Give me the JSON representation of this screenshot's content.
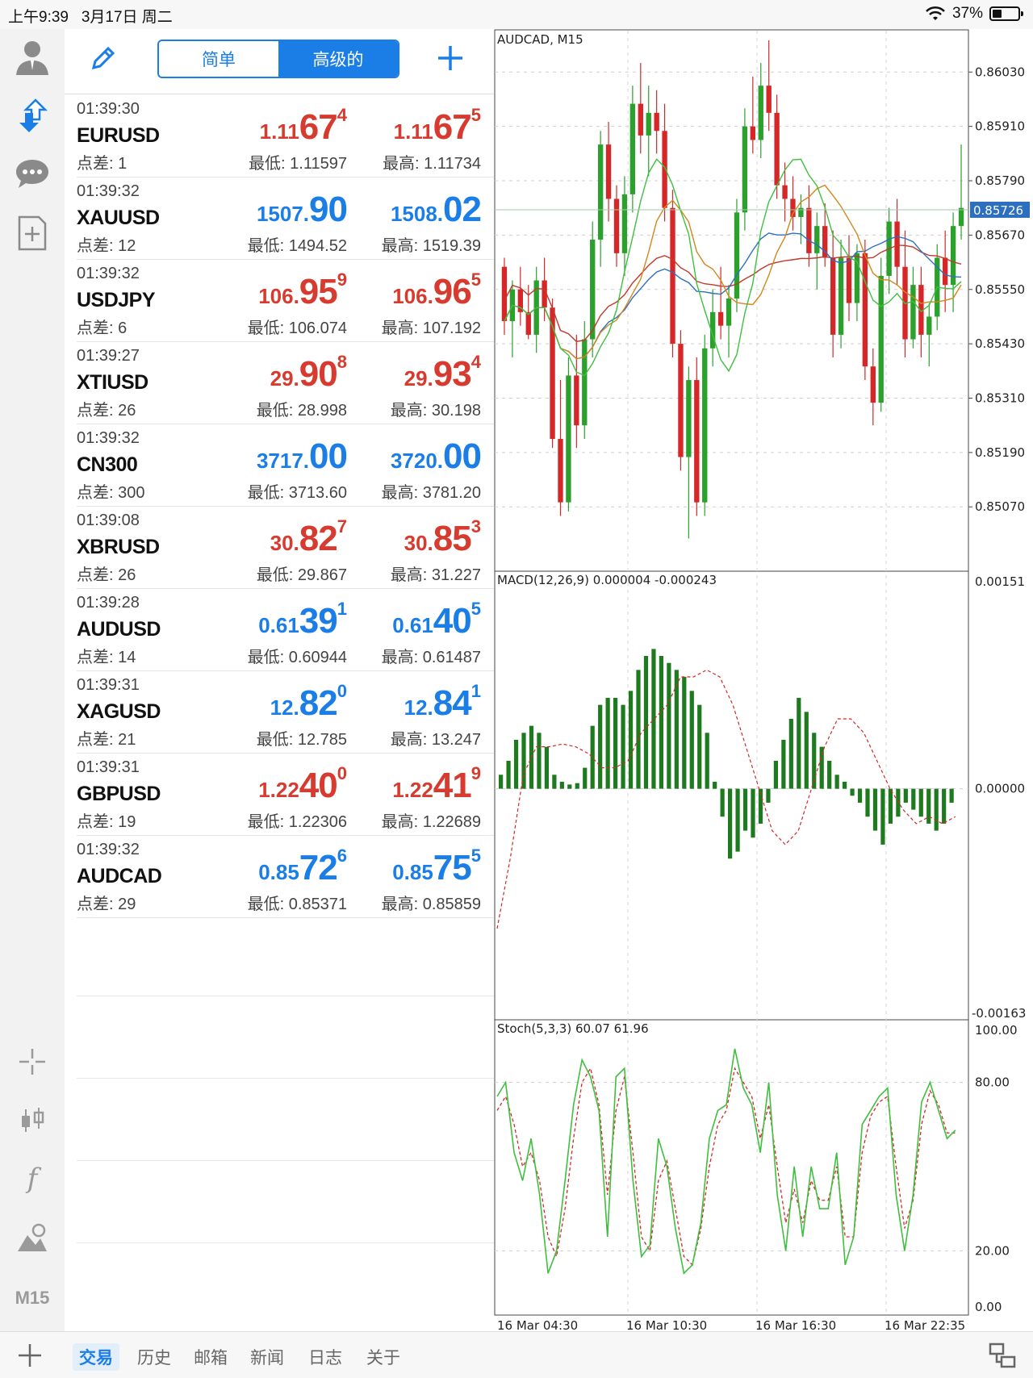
{
  "status_bar": {
    "time": "上午9:39",
    "date": "3月17日 周二",
    "battery": "37%",
    "battery_level": 0.37
  },
  "toolbar": {
    "seg_simple": "简单",
    "seg_advanced": "高级的"
  },
  "quotes": [
    {
      "time": "01:39:30",
      "symbol": "EURUSD",
      "spread": "点差: 1",
      "color": "red",
      "bid": {
        "pre": "1.11",
        "big": "67",
        "sup": "4"
      },
      "ask": {
        "pre": "1.11",
        "big": "67",
        "sup": "5"
      },
      "low": "最低: 1.11597",
      "high": "最高: 1.11734"
    },
    {
      "time": "01:39:32",
      "symbol": "XAUUSD",
      "spread": "点差: 12",
      "color": "blue",
      "bid": {
        "pre": "1507.",
        "big": "90",
        "sup": ""
      },
      "ask": {
        "pre": "1508.",
        "big": "02",
        "sup": ""
      },
      "low": "最低: 1494.52",
      "high": "最高: 1519.39"
    },
    {
      "time": "01:39:32",
      "symbol": "USDJPY",
      "spread": "点差: 6",
      "color": "red",
      "bid": {
        "pre": "106.",
        "big": "95",
        "sup": "9"
      },
      "ask": {
        "pre": "106.",
        "big": "96",
        "sup": "5"
      },
      "low": "最低: 106.074",
      "high": "最高: 107.192"
    },
    {
      "time": "01:39:27",
      "symbol": "XTIUSD",
      "spread": "点差: 26",
      "color": "red",
      "bid": {
        "pre": "29.",
        "big": "90",
        "sup": "8"
      },
      "ask": {
        "pre": "29.",
        "big": "93",
        "sup": "4"
      },
      "low": "最低: 28.998",
      "high": "最高: 30.198"
    },
    {
      "time": "01:39:32",
      "symbol": "CN300",
      "spread": "点差: 300",
      "color": "blue",
      "bid": {
        "pre": "3717.",
        "big": "00",
        "sup": ""
      },
      "ask": {
        "pre": "3720.",
        "big": "00",
        "sup": ""
      },
      "low": "最低: 3713.60",
      "high": "最高: 3781.20"
    },
    {
      "time": "01:39:08",
      "symbol": "XBRUSD",
      "spread": "点差: 26",
      "color": "red",
      "bid": {
        "pre": "30.",
        "big": "82",
        "sup": "7"
      },
      "ask": {
        "pre": "30.",
        "big": "85",
        "sup": "3"
      },
      "low": "最低: 29.867",
      "high": "最高: 31.227"
    },
    {
      "time": "01:39:28",
      "symbol": "AUDUSD",
      "spread": "点差: 14",
      "color": "blue",
      "bid": {
        "pre": "0.61",
        "big": "39",
        "sup": "1"
      },
      "ask": {
        "pre": "0.61",
        "big": "40",
        "sup": "5"
      },
      "low": "最低: 0.60944",
      "high": "最高: 0.61487"
    },
    {
      "time": "01:39:31",
      "symbol": "XAGUSD",
      "spread": "点差: 21",
      "color": "blue",
      "bid": {
        "pre": "12.",
        "big": "82",
        "sup": "0"
      },
      "ask": {
        "pre": "12.",
        "big": "84",
        "sup": "1"
      },
      "low": "最低: 12.785",
      "high": "最高: 13.247"
    },
    {
      "time": "01:39:31",
      "symbol": "GBPUSD",
      "spread": "点差: 19",
      "color": "red",
      "bid": {
        "pre": "1.22",
        "big": "40",
        "sup": "0"
      },
      "ask": {
        "pre": "1.22",
        "big": "41",
        "sup": "9"
      },
      "low": "最低: 1.22306",
      "high": "最高: 1.22689"
    },
    {
      "time": "01:39:32",
      "symbol": "AUDCAD",
      "spread": "点差: 29",
      "color": "blue",
      "bid": {
        "pre": "0.85",
        "big": "72",
        "sup": "6"
      },
      "ask": {
        "pre": "0.85",
        "big": "75",
        "sup": "5"
      },
      "low": "最低: 0.85371",
      "high": "最高: 0.85859"
    }
  ],
  "sidebar": {
    "timeframe": "M15"
  },
  "bottom_tabs": [
    {
      "label": "交易",
      "active": true
    },
    {
      "label": "历史",
      "active": false
    },
    {
      "label": "邮箱",
      "active": false
    },
    {
      "label": "新闻",
      "active": false
    },
    {
      "label": "日志",
      "active": false
    },
    {
      "label": "关于",
      "active": false
    }
  ],
  "chart_data": {
    "type": "candlestick",
    "symbol_label": "AUDCAD, M15",
    "price_axis": [
      "0.86030",
      "0.85910",
      "0.85790",
      "0.85670",
      "0.85550",
      "0.85430",
      "0.85310",
      "0.85190",
      "0.85070"
    ],
    "price_range": [
      0.8496,
      0.861
    ],
    "current_price": "0.85726",
    "current_value": 0.85726,
    "macd_label": "MACD(12,26,9) 0.000004 -0.000243",
    "macd_axis": {
      "top": "0.00151",
      "zero": "0.00000",
      "bottom": "-0.00163"
    },
    "macd_range": [
      -0.00163,
      0.00151
    ],
    "stoch_label": "Stoch(5,3,3) 60.07 61.96",
    "stoch_axis": [
      "100.00",
      "80.00",
      "20.00",
      "0.00"
    ],
    "stoch_range": [
      0,
      100
    ],
    "time_axis": [
      "16 Mar 04:30",
      "16 Mar 10:30",
      "16 Mar 16:30",
      "16 Mar 22:35"
    ],
    "colors": {
      "up": "#2ca02c",
      "down": "#d62728",
      "macd_hist": "#1e7a1e",
      "signal": "#d62728",
      "ma_red": "#c0392b",
      "ma_blue": "#2c6fbf",
      "ma_orange": "#d4861a",
      "ma_green": "#3fbf3f",
      "current_line": "#2c6fbf"
    },
    "candles": [
      [
        0.856,
        0.8562,
        0.8545,
        0.8548
      ],
      [
        0.8548,
        0.8557,
        0.854,
        0.8555
      ],
      [
        0.8555,
        0.856,
        0.8547,
        0.855
      ],
      [
        0.855,
        0.8556,
        0.8544,
        0.8545
      ],
      [
        0.8545,
        0.856,
        0.8541,
        0.8557
      ],
      [
        0.8557,
        0.8562,
        0.8548,
        0.8551
      ],
      [
        0.8551,
        0.8553,
        0.852,
        0.8522
      ],
      [
        0.8522,
        0.8535,
        0.8505,
        0.8508
      ],
      [
        0.8508,
        0.854,
        0.8506,
        0.8536
      ],
      [
        0.8536,
        0.8545,
        0.852,
        0.8525
      ],
      [
        0.8525,
        0.8548,
        0.8522,
        0.8544
      ],
      [
        0.8544,
        0.857,
        0.854,
        0.8566
      ],
      [
        0.8566,
        0.859,
        0.856,
        0.8587
      ],
      [
        0.8587,
        0.8592,
        0.857,
        0.8575
      ],
      [
        0.8575,
        0.8578,
        0.856,
        0.8563
      ],
      [
        0.8563,
        0.858,
        0.8558,
        0.8576
      ],
      [
        0.8576,
        0.86,
        0.8572,
        0.8596
      ],
      [
        0.8596,
        0.8605,
        0.8585,
        0.8589
      ],
      [
        0.8589,
        0.86,
        0.858,
        0.8594
      ],
      [
        0.8594,
        0.8599,
        0.8585,
        0.859
      ],
      [
        0.859,
        0.8596,
        0.857,
        0.8573
      ],
      [
        0.8573,
        0.8577,
        0.854,
        0.8543
      ],
      [
        0.8543,
        0.8546,
        0.8515,
        0.8518
      ],
      [
        0.8518,
        0.8538,
        0.85,
        0.8535
      ],
      [
        0.8535,
        0.854,
        0.8505,
        0.8508
      ],
      [
        0.8508,
        0.8545,
        0.8505,
        0.8542
      ],
      [
        0.8542,
        0.8555,
        0.8538,
        0.855
      ],
      [
        0.855,
        0.856,
        0.8544,
        0.8547
      ],
      [
        0.8547,
        0.8556,
        0.854,
        0.8553
      ],
      [
        0.8553,
        0.8575,
        0.855,
        0.8572
      ],
      [
        0.8572,
        0.8595,
        0.8568,
        0.8591
      ],
      [
        0.8591,
        0.8602,
        0.8585,
        0.8588
      ],
      [
        0.8588,
        0.8605,
        0.8584,
        0.86
      ],
      [
        0.86,
        0.861,
        0.859,
        0.8594
      ],
      [
        0.8594,
        0.8598,
        0.8575,
        0.8578
      ],
      [
        0.8578,
        0.8583,
        0.857,
        0.8575
      ],
      [
        0.8575,
        0.858,
        0.8568,
        0.8571
      ],
      [
        0.8571,
        0.8576,
        0.8565,
        0.8573
      ],
      [
        0.8573,
        0.8578,
        0.856,
        0.8563
      ],
      [
        0.8563,
        0.8572,
        0.8555,
        0.8569
      ],
      [
        0.8569,
        0.8574,
        0.856,
        0.8562
      ],
      [
        0.8562,
        0.8568,
        0.854,
        0.8545
      ],
      [
        0.8545,
        0.8566,
        0.8542,
        0.8562
      ],
      [
        0.8562,
        0.8567,
        0.8548,
        0.8552
      ],
      [
        0.8552,
        0.8565,
        0.8548,
        0.8563
      ],
      [
        0.8563,
        0.8566,
        0.8535,
        0.8538
      ],
      [
        0.8538,
        0.8542,
        0.8525,
        0.853
      ],
      [
        0.853,
        0.8562,
        0.8528,
        0.8558
      ],
      [
        0.8558,
        0.8573,
        0.8554,
        0.857
      ],
      [
        0.857,
        0.8575,
        0.8556,
        0.856
      ],
      [
        0.856,
        0.8568,
        0.854,
        0.8544
      ],
      [
        0.8544,
        0.856,
        0.8542,
        0.8556
      ],
      [
        0.8556,
        0.856,
        0.854,
        0.8545
      ],
      [
        0.8545,
        0.8552,
        0.8538,
        0.8549
      ],
      [
        0.8549,
        0.8565,
        0.8546,
        0.8562
      ],
      [
        0.8562,
        0.8568,
        0.855,
        0.8556
      ],
      [
        0.8556,
        0.8572,
        0.855,
        0.8569
      ],
      [
        0.8569,
        0.8587,
        0.8566,
        0.8573
      ]
    ],
    "macd_hist": [
      0.0001,
      0.0002,
      0.00035,
      0.0004,
      0.00045,
      0.0004,
      0.0003,
      0.0001,
      5e-05,
      3e-05,
      4e-05,
      0.00015,
      0.00045,
      0.0006,
      0.00065,
      0.00065,
      0.0006,
      0.0007,
      0.00085,
      0.00095,
      0.001,
      0.00095,
      0.0009,
      0.00085,
      0.0008,
      0.0007,
      0.0006,
      0.0004,
      5e-05,
      -0.0002,
      -0.0005,
      -0.00045,
      -0.0003,
      -0.00035,
      -0.00025,
      -0.0001,
      0.0002,
      0.00035,
      0.0005,
      0.00065,
      0.00055,
      0.0004,
      0.0003,
      0.0002,
      0.0001,
      5e-05,
      -5e-05,
      -0.0001,
      -0.0002,
      -0.0003,
      -0.0004,
      -0.00025,
      -0.0002,
      -0.0001,
      -0.00015,
      -0.0002,
      -0.00025,
      -0.0003,
      -0.00025,
      -0.0001
    ],
    "macd_signal": [
      -0.001,
      -0.0005,
      0.0001,
      0.0003,
      0.0003,
      0.00032,
      0.0003,
      0.00025,
      0.00015,
      0.00015,
      0.0002,
      0.0004,
      0.0005,
      0.0006,
      0.0008,
      0.0008,
      0.00085,
      0.0008,
      0.0006,
      0.0003,
      0.0,
      -0.0003,
      -0.0004,
      -0.0003,
      0.0,
      0.0003,
      0.0005,
      0.0005,
      0.0004,
      0.0002,
      0.0,
      -0.00015,
      -0.00025,
      -0.0002,
      -0.00025,
      -0.0002
    ],
    "stoch_main": [
      75,
      80,
      55,
      45,
      60,
      40,
      12,
      20,
      45,
      72,
      88,
      82,
      70,
      25,
      82,
      85,
      45,
      18,
      22,
      60,
      50,
      28,
      12,
      15,
      30,
      60,
      70,
      72,
      92,
      78,
      72,
      55,
      80,
      40,
      20,
      50,
      25,
      50,
      35,
      35,
      55,
      15,
      25,
      65,
      70,
      75,
      78,
      40,
      20,
      40,
      73,
      80,
      70,
      60,
      63
    ],
    "stoch_signal": [
      70,
      75,
      65,
      50,
      55,
      45,
      25,
      18,
      35,
      60,
      80,
      85,
      72,
      40,
      70,
      82,
      55,
      25,
      20,
      45,
      52,
      35,
      18,
      15,
      28,
      50,
      65,
      70,
      85,
      80,
      75,
      60,
      72,
      50,
      30,
      42,
      30,
      45,
      38,
      38,
      50,
      25,
      25,
      55,
      68,
      73,
      75,
      50,
      28,
      38,
      65,
      77,
      72,
      62,
      62
    ]
  }
}
